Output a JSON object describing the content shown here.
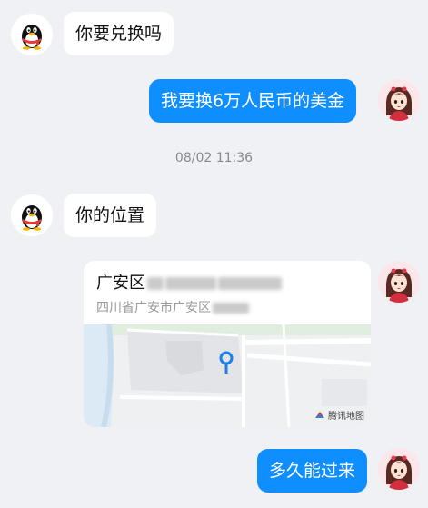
{
  "messages": {
    "m1": "你要兑换吗",
    "m2": "我要换6万人民币的美金",
    "timestamp": "08/02 11:36",
    "m3": "你的位置",
    "m4": "多久能过来"
  },
  "location_card": {
    "title": "广安区",
    "subtitle": "四川省广安市广安区",
    "map_brand": "腾讯地图"
  },
  "colors": {
    "outgoing_bubble": "#0f8fff",
    "incoming_bubble": "#ffffff",
    "background": "#f0f1f5",
    "map_pin": "#1a7fe6"
  }
}
